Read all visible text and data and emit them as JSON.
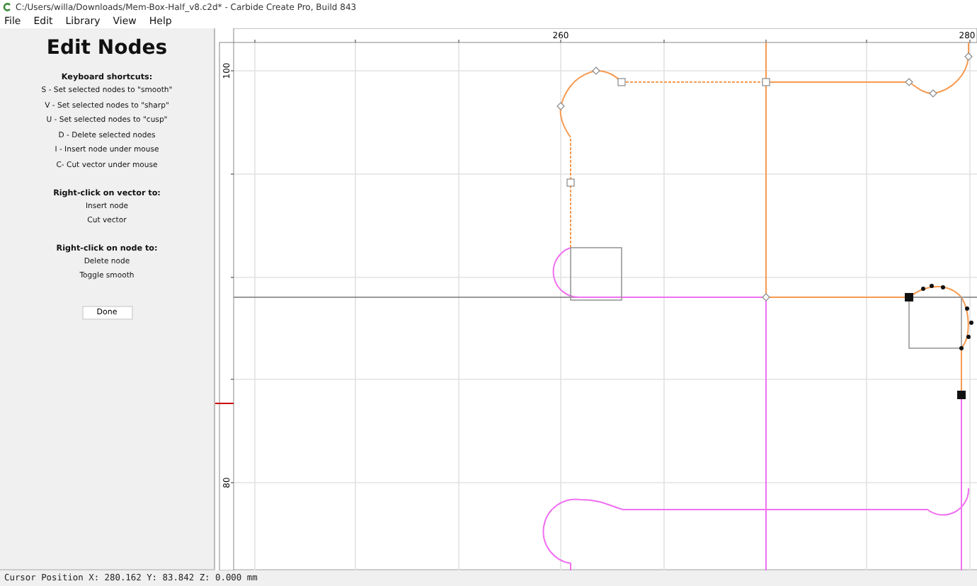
{
  "window": {
    "title": "C:/Users/willa/Downloads/Mem-Box-Half_v8.c2d* - Carbide Create Pro, Build 843"
  },
  "menu": [
    "File",
    "Edit",
    "Library",
    "View",
    "Help"
  ],
  "panel": {
    "title": "Edit Nodes",
    "sections": [
      {
        "heading": "Keyboard shortcuts:",
        "lines": [
          "S - Set selected nodes to \"smooth\"",
          "V - Set selected nodes to \"sharp\"",
          "U - Set selected nodes to \"cusp\"",
          "D - Delete selected nodes",
          "I - Insert node under mouse",
          "C- Cut vector under mouse"
        ]
      },
      {
        "heading": "Right-click on vector to:",
        "lines": [
          "Insert node",
          "Cut vector"
        ]
      },
      {
        "heading": "Right-click on node to:",
        "lines": [
          "Delete node",
          "Toggle smooth"
        ]
      }
    ],
    "button": "Done"
  },
  "rulers": {
    "x_labels": [
      "260",
      "280"
    ],
    "y_labels": [
      "100",
      "80"
    ]
  },
  "status_bar": "Cursor Position X: 280.162 Y: 83.842 Z: 0.000 mm"
}
